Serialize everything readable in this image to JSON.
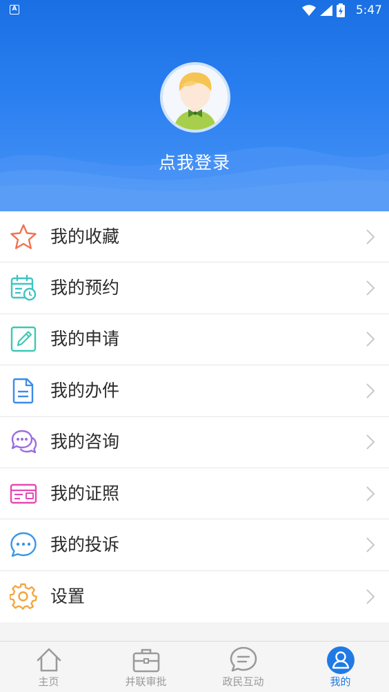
{
  "status_bar": {
    "time": "5:47",
    "notification_badge": "A"
  },
  "profile": {
    "login_prompt": "点我登录"
  },
  "menu": {
    "items": [
      {
        "label": "我的收藏",
        "icon": "star-icon",
        "color": "#f0734f"
      },
      {
        "label": "我的预约",
        "icon": "calendar-clock-icon",
        "color": "#3fc4c4"
      },
      {
        "label": "我的申请",
        "icon": "pencil-edit-icon",
        "color": "#3cc8b4"
      },
      {
        "label": "我的办件",
        "icon": "document-icon",
        "color": "#3a8be8"
      },
      {
        "label": "我的咨询",
        "icon": "chat-bubbles-icon",
        "color": "#9b6ce0"
      },
      {
        "label": "我的证照",
        "icon": "id-card-icon",
        "color": "#e648b4"
      },
      {
        "label": "我的投诉",
        "icon": "message-dots-icon",
        "color": "#3a95e6"
      },
      {
        "label": "设置",
        "icon": "gear-icon",
        "color": "#f3a53b"
      }
    ]
  },
  "tabbar": {
    "tabs": [
      {
        "label": "主页",
        "icon": "home-icon",
        "active": false
      },
      {
        "label": "并联审批",
        "icon": "briefcase-icon",
        "active": false
      },
      {
        "label": "政民互动",
        "icon": "chat-icon",
        "active": false
      },
      {
        "label": "我的",
        "icon": "user-icon",
        "active": true
      }
    ],
    "active_color": "#1f7ae6",
    "inactive_color": "#9a9a9a"
  }
}
